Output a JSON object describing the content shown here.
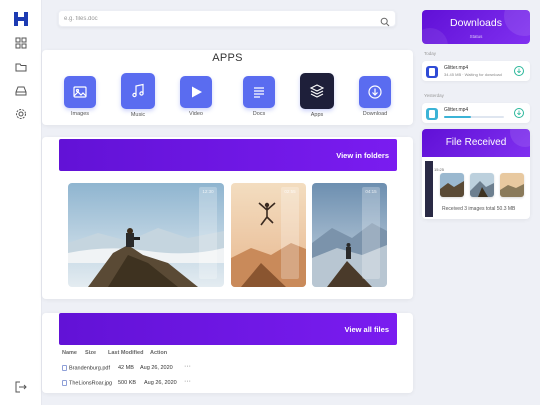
{
  "search": {
    "placeholder": "e.g. files.doc"
  },
  "apps": {
    "title": "APPS",
    "items": [
      {
        "label": "Images",
        "icon": "image-icon"
      },
      {
        "label": "Music",
        "icon": "music-icon"
      },
      {
        "label": "Video",
        "icon": "play-icon"
      },
      {
        "label": "Docs",
        "icon": "doc-icon"
      },
      {
        "label": "Apps",
        "icon": "layers-icon"
      },
      {
        "label": "Download",
        "icon": "download-icon"
      }
    ]
  },
  "photos": {
    "view_label": "View in folders",
    "durations": [
      "12:30",
      "02:55",
      "04:15"
    ]
  },
  "recent": {
    "view_label": "View all files",
    "columns": [
      "Name",
      "Size",
      "Last Modified",
      "Action"
    ],
    "rows": [
      {
        "name": "Brandenburg.pdf",
        "size": "42 MB",
        "modified": "Aug 26, 2020",
        "action": "···"
      },
      {
        "name": "TheLionsRoar.jpg",
        "size": "500 KB",
        "modified": "Aug 26, 2020",
        "action": "···"
      }
    ]
  },
  "downloads": {
    "title": "Downloads",
    "subtitle": "Status",
    "today_label": "Today",
    "yesterday_label": "Yesterday",
    "items": [
      {
        "name": "Glitter.mp4",
        "meta": "34.45 MB · Waiting for download",
        "color": "#2f4bd6"
      },
      {
        "name": "Glitter.mp4",
        "progress": 0.45,
        "color": "#3bb3d6"
      }
    ]
  },
  "file_received": {
    "title": "File Received",
    "time": "15:25",
    "message": "Received 3 images total 50.3 MB"
  },
  "colors": {
    "accent": "#6a14e6",
    "tile": "#5a6cf0",
    "brand": "#1d3bb2"
  }
}
